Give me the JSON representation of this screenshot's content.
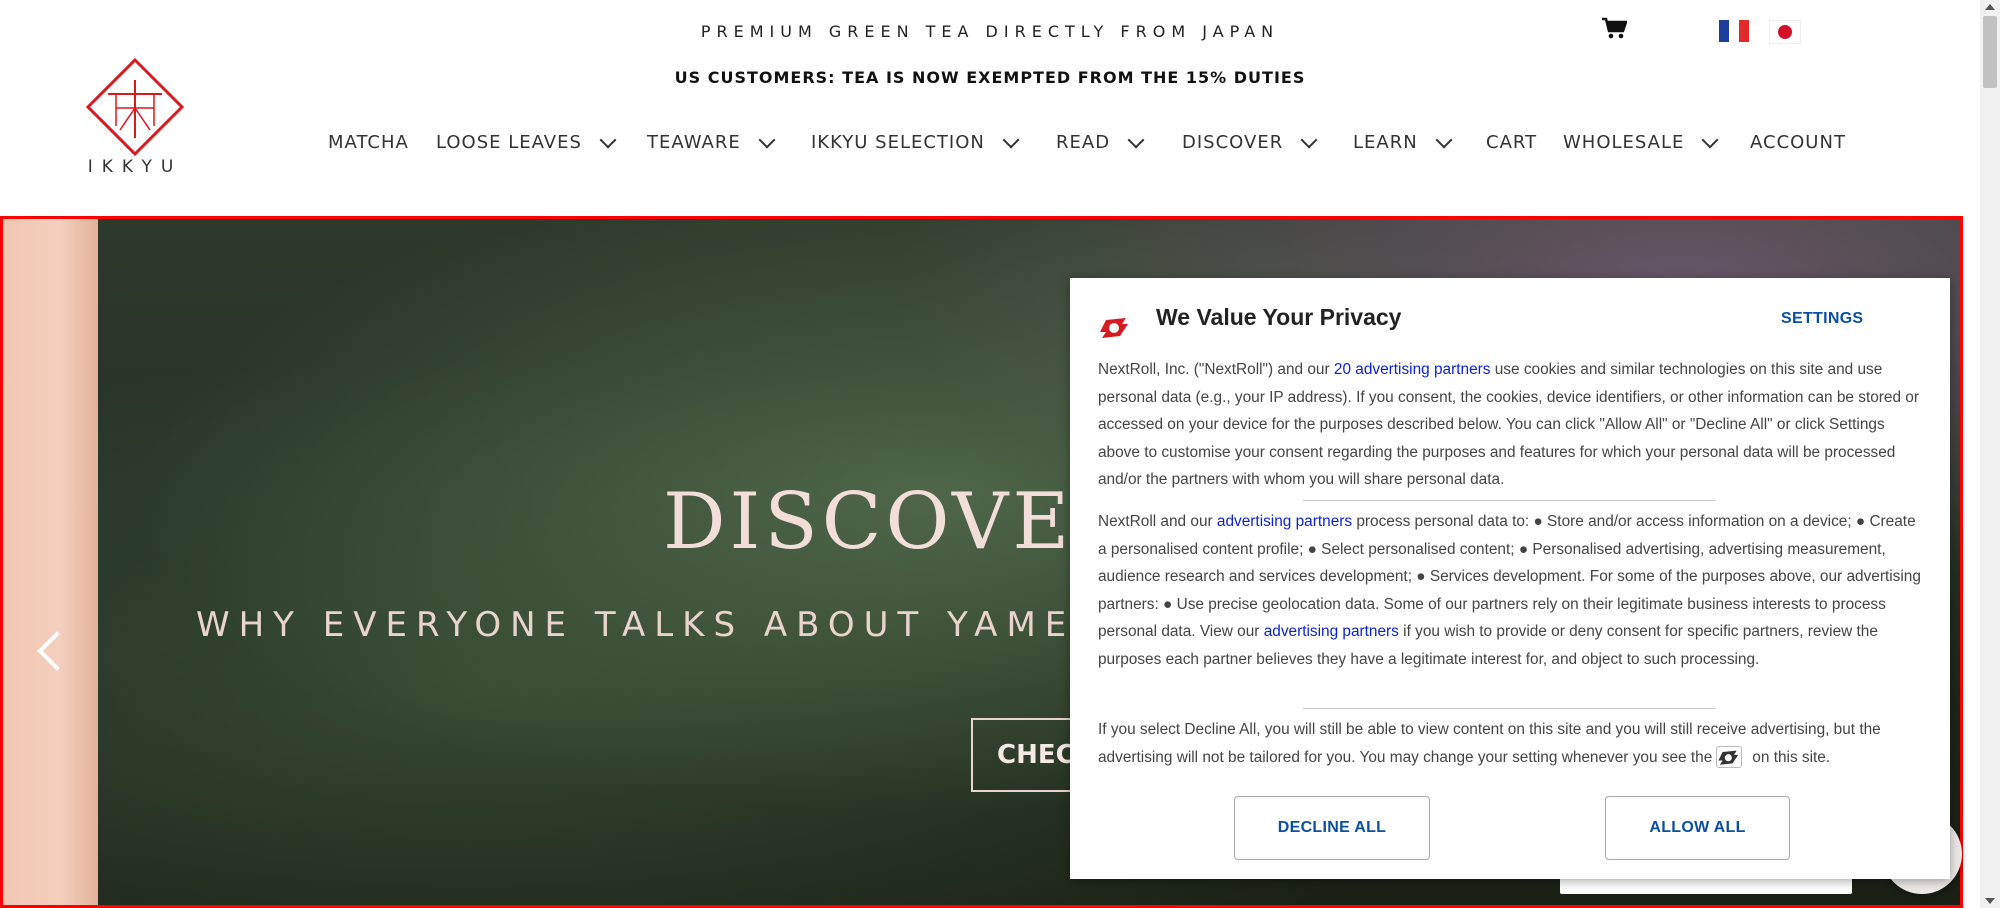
{
  "header": {
    "tagline": "PREMIUM GREEN TEA DIRECTLY FROM JAPAN",
    "notice": "US CUSTOMERS: TEA IS NOW EXEMPTED FROM THE 15% DUTIES",
    "logo_text": "IKKYU",
    "icons": {
      "cart": "cart-icon",
      "flag_fr": "france-flag-icon",
      "flag_jp": "japan-flag-icon"
    }
  },
  "nav": {
    "items": [
      {
        "label": "MATCHA",
        "dropdown": false
      },
      {
        "label": "LOOSE LEAVES",
        "dropdown": true
      },
      {
        "label": "TEAWARE",
        "dropdown": true
      },
      {
        "label": "IKKYU SELECTION",
        "dropdown": true
      },
      {
        "label": "READ",
        "dropdown": true
      },
      {
        "label": "DISCOVER",
        "dropdown": true
      },
      {
        "label": "LEARN",
        "dropdown": true
      },
      {
        "label": "CART",
        "dropdown": false
      },
      {
        "label": "WHOLESALE",
        "dropdown": true
      },
      {
        "label": "ACCOUNT",
        "dropdown": false
      }
    ]
  },
  "hero": {
    "title": "DISCOVER",
    "subtitle": "WHY EVERYONE TALKS ABOUT YAME",
    "cta": "CHEC"
  },
  "consent": {
    "title": "We Value Your Privacy",
    "settings": "SETTINGS",
    "p1": {
      "before": "NextRoll, Inc. (\"NextRoll\") and our ",
      "link": "20 advertising partners",
      "after": " use cookies and similar technologies on this site and use personal data (e.g., your IP address). If you consent, the cookies, device identifiers, or other information can be stored or accessed on your device for the purposes described below. You can click \"Allow All\" or \"Decline All\" or click Settings above to customise your consent regarding the purposes and features for which your personal data will be processed and/or the partners with whom you will share personal data."
    },
    "p2": {
      "before": "NextRoll and our ",
      "link1": "advertising partners",
      "middle": " process personal data to: ● Store and/or access information on a device; ● Create a personalised content profile; ● Select personalised content; ● Personalised advertising, advertising measurement, audience research and services development; ● Services development. For some of the purposes above, our advertising partners: ● Use precise geolocation data. Some of our partners rely on their legitimate business interests to process personal data. View our ",
      "link2": "advertising partners",
      "after": " if you wish to provide or deny consent for specific partners, review the purposes each partner believes they have a legitimate interest for, and object to such processing."
    },
    "p3": {
      "before": "If you select Decline All, you will still be able to view content on this site and you will still receive advertising, but the advertising will not be tailored for you. You may change your setting whenever you see the",
      "after": "on this site."
    },
    "decline": "DECLINE ALL",
    "allow": "ALLOW ALL",
    "icons": {
      "brand": "nextroll-logo-icon"
    }
  },
  "colors": {
    "accent_red": "#d71920",
    "link_blue": "#0a1fd8",
    "button_blue": "#0b4fa3",
    "hero_frame": "#ff0000"
  }
}
